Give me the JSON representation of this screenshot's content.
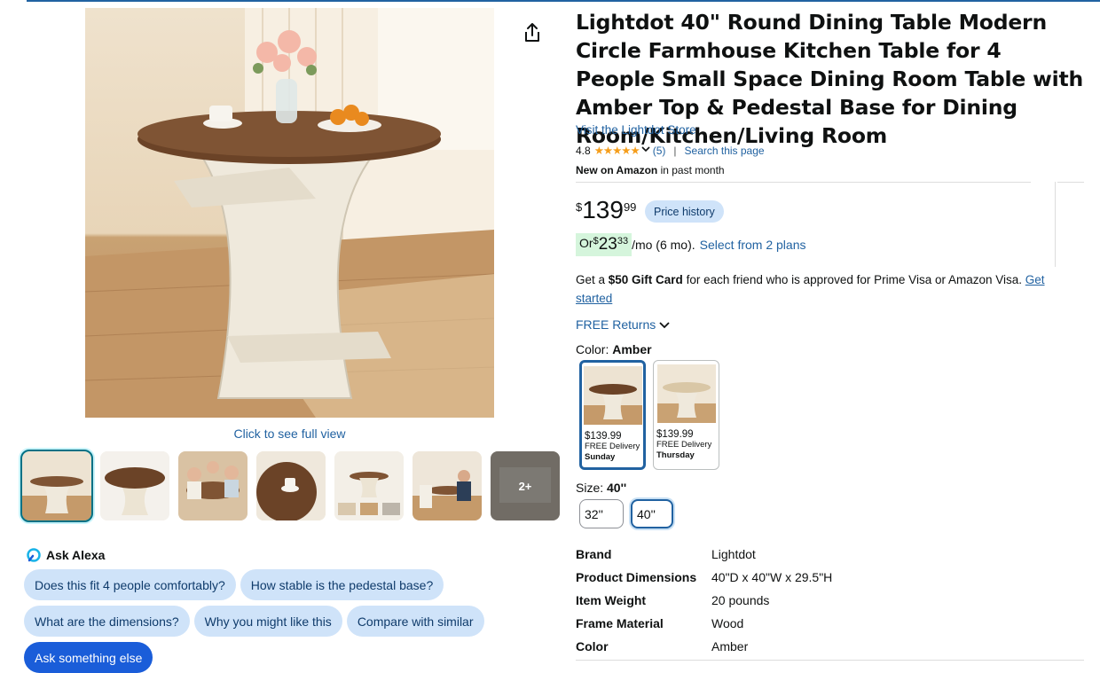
{
  "product": {
    "title": "Lightdot 40\" Round Dining Table Modern Circle Farmhouse Kitchen Table for 4 People Small Space Dining Room Table with Amber Top & Pedestal Base for Dining Room/Kitchen/Living Room",
    "store_link": "Visit the Lightdot Store",
    "rating": "4.8",
    "stars": "★★★★★",
    "rating_count": "(5)",
    "search_page": "Search this page",
    "new_on_bold": "New on Amazon",
    "new_on_rest": " in past month"
  },
  "price": {
    "symbol": "$",
    "whole": "139",
    "fraction": "99",
    "history_label": "Price history",
    "monthly_prefix": "Or ",
    "monthly_symbol": "$",
    "monthly_whole": "23",
    "monthly_fraction": "33",
    "monthly_suffix": "/mo (6 mo).",
    "plans_link": "Select from 2 plans"
  },
  "promo": {
    "prefix": "Get a ",
    "bold": "$50 Gift Card",
    "middle": " for each friend who is approved for Prime Visa or Amazon Visa. ",
    "link": "Get started"
  },
  "returns_label": "FREE Returns",
  "color": {
    "label": "Color: ",
    "selected": "Amber",
    "options": [
      {
        "price": "$139.99",
        "delivery": "FREE Delivery",
        "day": "Sunday"
      },
      {
        "price": "$139.99",
        "delivery": "FREE Delivery",
        "day": "Thursday"
      }
    ]
  },
  "size": {
    "label": "Size: ",
    "selected": "40''",
    "options": [
      "32''",
      "40''"
    ]
  },
  "specs": [
    {
      "key": "Brand",
      "value": "Lightdot"
    },
    {
      "key": "Product Dimensions",
      "value": "40\"D x 40\"W x 29.5\"H"
    },
    {
      "key": "Item Weight",
      "value": "20 pounds"
    },
    {
      "key": "Frame Material",
      "value": "Wood"
    },
    {
      "key": "Color",
      "value": "Amber"
    }
  ],
  "gallery": {
    "full_view": "Click to see full view",
    "more_label": "2+"
  },
  "alexa": {
    "title": "Ask Alexa",
    "chips": [
      "Does this fit 4 people comfortably?",
      "How stable is the pedestal base?",
      "What are the dimensions?",
      "Why you might like this",
      "Compare with similar",
      "Ask something else"
    ]
  },
  "colors": {
    "link": "#2162a1",
    "chip_bg": "#cfe3f9",
    "chip_primary": "#1a5dd9",
    "star": "#f59e1c",
    "teal_selected": "#007185"
  }
}
